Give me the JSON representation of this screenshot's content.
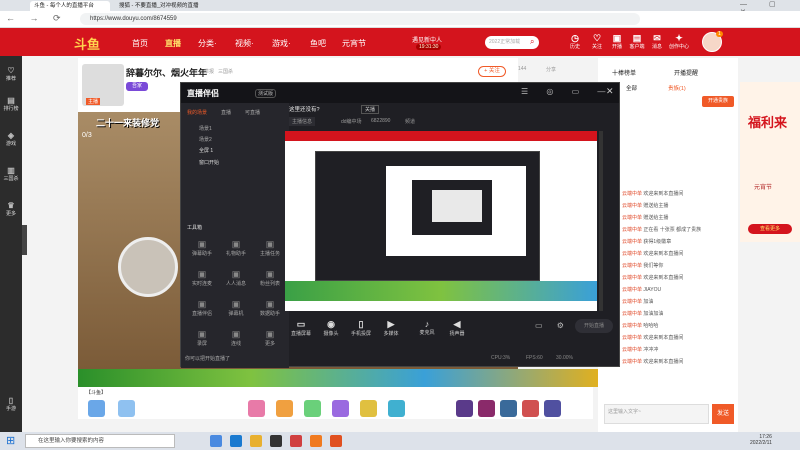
{
  "browser": {
    "tabs": [
      {
        "label": "斗鱼 - 每个人的直播平台"
      },
      {
        "label": "搜狐 - 不要直播_对冲视频的直播"
      }
    ],
    "url": "https://www.douyu.com/8674559"
  },
  "header": {
    "logo": "斗鱼",
    "nav": [
      "首页",
      "直播",
      "分类·",
      "视频·",
      "游戏·",
      "鱼吧",
      "元宵节"
    ],
    "promo_top": "遇见新中人",
    "promo_bottom": "19:31:30",
    "search_placeholder": "2022正常加载",
    "icons": [
      "历史",
      "关注",
      "开播",
      "客户端",
      "消息",
      "创作中心"
    ],
    "avatar_badge": "1"
  },
  "sidebar": {
    "items": [
      "推荐",
      "排行榜",
      "游戏",
      "三国杀",
      "更多",
      "手游"
    ]
  },
  "stream": {
    "title": "辞暮尔尔、烟火年年",
    "tag": "举报",
    "category": "三国杀",
    "follow_label": "+ 关注",
    "count": "144",
    "share_label": "分享",
    "host_label": "主播",
    "nickname": "吾家",
    "bottom_label": "【斗鱼】",
    "video_caption": "二十一来装修党"
  },
  "overlay": {
    "app_title": "直播伴侣",
    "version": "测试版",
    "menu": [
      "我的场景",
      "直播",
      "可直播"
    ],
    "scenes": [
      "场景1",
      "场景2",
      "全屏 1",
      "窗口开始"
    ],
    "tools_label": "工具箱",
    "tools": [
      "弹幕助手",
      "礼物助手",
      "主播任务",
      "实时连麦",
      "人人消息",
      "粉丝列表",
      "直播伴侣",
      "弹幕机",
      "数据助手",
      "录屏",
      "连线",
      "更多"
    ],
    "topbar": [
      "这里还没有?",
      "关播"
    ],
    "stats": [
      "主播信息",
      "在线",
      "dd编中场",
      "6822890",
      "频道"
    ],
    "bottom": [
      "直播屏幕",
      "摄像头",
      "手机投屏",
      "多媒体",
      "麦克风",
      "扬声器"
    ],
    "footer_note": "你可以把开始直播了",
    "footer_stats": [
      "CPU:3%",
      "FPS:60",
      "30.00%"
    ],
    "start_button": "开始直播"
  },
  "right_panel": {
    "tabs": [
      "十棒榜单",
      "开播提醒"
    ],
    "subtabs": [
      "全部",
      "贵族(1)",
      "房管"
    ],
    "open_btn": "开通贵族",
    "user_line": "欢迎来到本直播间",
    "chat": [
      {
        "user": "云端中单",
        "text": "欢迎来到本直播间"
      },
      {
        "user": "云端中单",
        "text": "赠送给主播"
      },
      {
        "user": "云端中单",
        "text": "赠送给主播"
      },
      {
        "user": "云端中单",
        "text": "正在看 十张票 都成了贵族"
      },
      {
        "user": "云端中单",
        "text": "获得1级徽章"
      },
      {
        "user": "云端中单",
        "text": "欢迎来到本直播间"
      },
      {
        "user": "云端中单",
        "text": "我们等你"
      },
      {
        "user": "云端中单",
        "text": "欢迎来到本直播间"
      },
      {
        "user": "云端中单",
        "text": "JIAYOU"
      },
      {
        "user": "云端中单",
        "text": "加油"
      },
      {
        "user": "云端中单",
        "text": "加油加油"
      },
      {
        "user": "云端中单",
        "text": "哈哈哈"
      },
      {
        "user": "云端中单",
        "text": "欢迎来到本直播间"
      },
      {
        "user": "云端中单",
        "text": "冲冲冲"
      },
      {
        "user": "云端中单",
        "text": "欢迎来到本直播间"
      }
    ],
    "input_placeholder": "这里输入文字~",
    "send_label": "发送"
  },
  "ad": {
    "title": "福利来",
    "sub": "元宵节",
    "cta": "查看更多"
  },
  "taskbar": {
    "search_placeholder": "在这里输入你要搜索的内容",
    "time": "17:26",
    "date": "2022/2/11"
  },
  "colors": {
    "brand": "#d4141d",
    "dark": "#1f1f24",
    "accent": "#f05a28"
  }
}
